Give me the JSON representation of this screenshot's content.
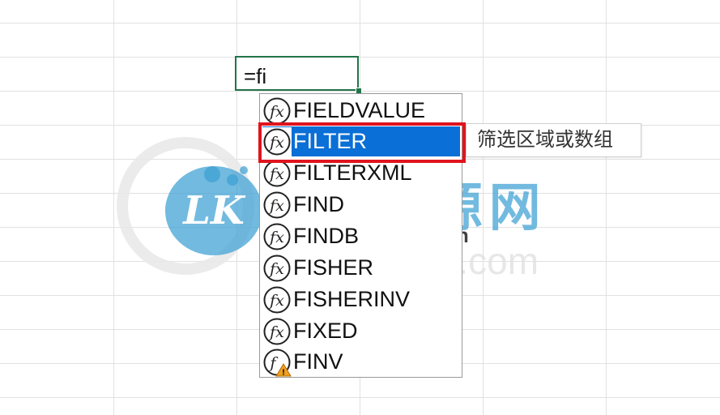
{
  "cell": {
    "formula": "=fi"
  },
  "autocomplete": {
    "items": [
      {
        "label": "FIELDVALUE",
        "icon": "function-icon",
        "selected": false
      },
      {
        "label": "FILTER",
        "icon": "function-icon",
        "selected": true
      },
      {
        "label": "FILTERXML",
        "icon": "function-icon",
        "selected": false
      },
      {
        "label": "FIND",
        "icon": "function-icon",
        "selected": false
      },
      {
        "label": "FINDB",
        "icon": "function-icon",
        "selected": false
      },
      {
        "label": "FISHER",
        "icon": "function-icon",
        "selected": false
      },
      {
        "label": "FISHERINV",
        "icon": "function-icon",
        "selected": false
      },
      {
        "label": "FIXED",
        "icon": "function-icon",
        "selected": false
      },
      {
        "label": "FINV",
        "icon": "function-warning-icon",
        "selected": false
      }
    ]
  },
  "tooltip": {
    "text": "筛选区域或数组"
  },
  "watermark": {
    "logo_text": "LK",
    "chinese_text": "老K资源网",
    "url": "bbs.laokbk.cn",
    "ghost_text": "e13zn.com"
  },
  "colors": {
    "cell_border": "#21744a",
    "selection": "#0a6fd6",
    "highlight_box": "#e0141e",
    "watermark_blue": "#3ca0d2"
  }
}
